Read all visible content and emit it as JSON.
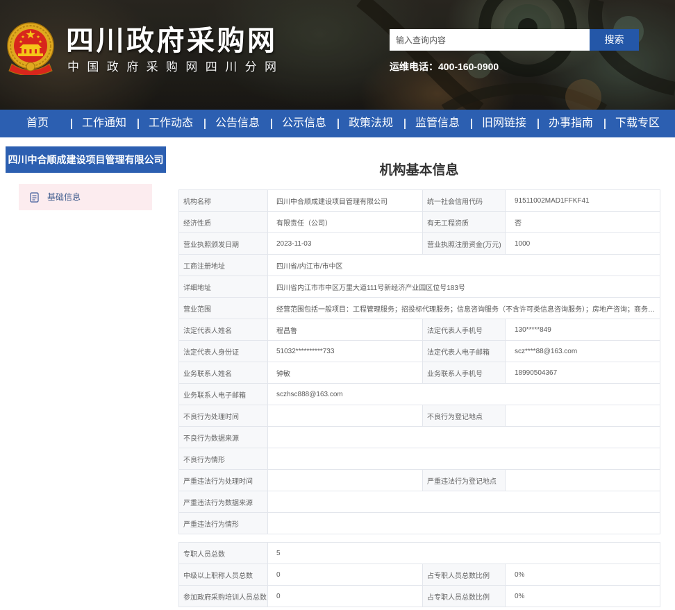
{
  "header": {
    "logo_icon": "national-emblem-icon",
    "site_title": "四川政府采购网",
    "site_subtitle": "中国政府采购网四川分网",
    "search": {
      "placeholder": "输入查询内容",
      "value": "",
      "button_label": "搜索"
    },
    "hotline": "运维电话：400-160-0900"
  },
  "nav": {
    "items": [
      {
        "label": "首页"
      },
      {
        "label": "工作通知"
      },
      {
        "label": "工作动态"
      },
      {
        "label": "公告信息"
      },
      {
        "label": "公示信息"
      },
      {
        "label": "政策法规"
      },
      {
        "label": "监管信息"
      },
      {
        "label": "旧网链接"
      },
      {
        "label": "办事指南"
      },
      {
        "label": "下载专区"
      }
    ]
  },
  "sidebar": {
    "title": "四川中合顺成建设项目管理有限公司",
    "items": [
      {
        "label": "基础信息",
        "icon": "document-icon",
        "active": true
      }
    ]
  },
  "main": {
    "title": "机构基本信息",
    "basic_info": [
      {
        "label1": "机构名称",
        "value1": "四川中合顺成建设项目管理有限公司",
        "label2": "统一社会信用代码",
        "value2": "91511002MAD1FFKF41"
      },
      {
        "label1": "经济性质",
        "value1": "有限责任（公司）",
        "label2": "有无工程资质",
        "value2": "否"
      },
      {
        "label1": "营业执照颁发日期",
        "value1": "2023-11-03",
        "label2": "营业执照注册资金(万元)",
        "value2": "1000"
      },
      {
        "label1": "工商注册地址",
        "value1": "四川省/内江市/市中区"
      },
      {
        "label1": "详细地址",
        "value1": "四川省内江市市中区万里大道111号新经济产业园区位号183号"
      },
      {
        "label1": "营业范围",
        "value1": "经营范围包括一般项目：工程管理服务；招投标代理服务；信息咨询服务（不含许可类信息咨询服务）；房地产咨询；商务代..."
      },
      {
        "label1": "法定代表人姓名",
        "value1": "程昌鲁",
        "label2": "法定代表人手机号",
        "value2": "130*****849"
      },
      {
        "label1": "法定代表人身份证",
        "value1": "51032**********733",
        "label2": "法定代表人电子邮箱",
        "value2": "scz****88@163.com"
      },
      {
        "label1": "业务联系人姓名",
        "value1": "钟敏",
        "label2": "业务联系人手机号",
        "value2": "18990504367"
      },
      {
        "label1": "业务联系人电子邮箱",
        "value1": "sczhsc888@163.com"
      },
      {
        "label1": "不良行为处理时间",
        "value1": "",
        "label2": "不良行为登记地点",
        "value2": ""
      },
      {
        "label1": "不良行为数据来源",
        "value1": ""
      },
      {
        "label1": "不良行为情形",
        "value1": ""
      },
      {
        "label1": "严重违法行为处理时间",
        "value1": "",
        "label2": "严重违法行为登记地点",
        "value2": ""
      },
      {
        "label1": "严重违法行为数据来源",
        "value1": ""
      },
      {
        "label1": "严重违法行为情形",
        "value1": ""
      }
    ],
    "staff_info": [
      {
        "label1": "专职人员总数",
        "value1": "5"
      },
      {
        "label1": "中级以上职称人员总数",
        "value1": "0",
        "label2": "占专职人员总数比例",
        "value2": "0%"
      },
      {
        "label1": "参加政府采购培训人员总数",
        "value1": "0",
        "label2": "占专职人员总数比例",
        "value2": "0%"
      }
    ]
  },
  "colors": {
    "primary_blue": "#2c5fb1",
    "search_button": "#2457a8",
    "active_menu_bg": "#fcecef",
    "label_cell_bg": "#f7f8fa",
    "table_border": "#e3e6ec",
    "emblem_red": "#d8261c",
    "emblem_gold": "#e0a91f"
  }
}
